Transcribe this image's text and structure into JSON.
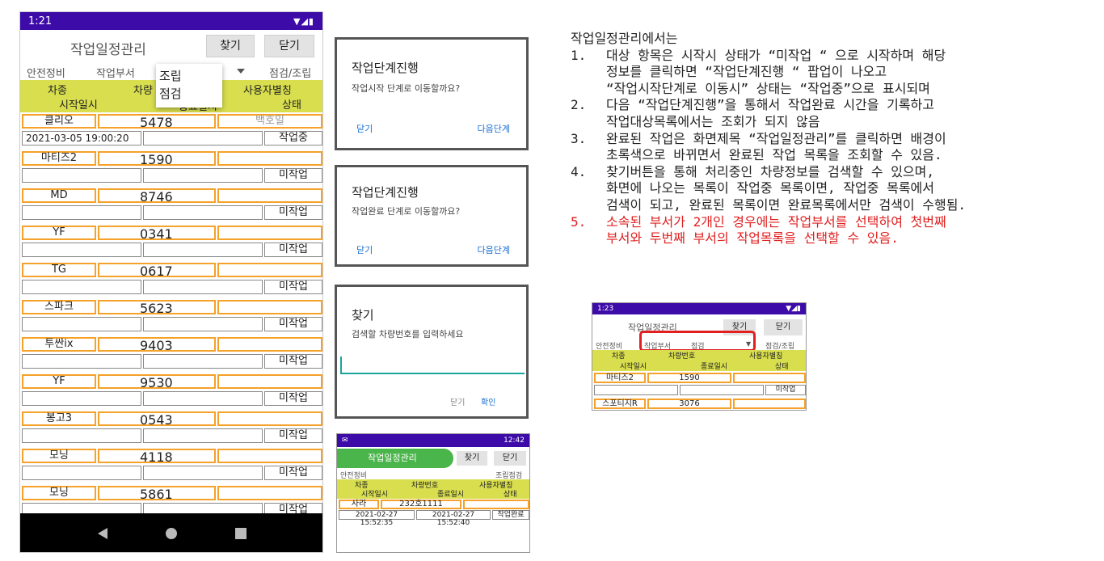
{
  "main_phone": {
    "status_time": "1:21",
    "title": "작업일정관리",
    "find_button": "찾기",
    "close_button": "닫기",
    "filter": {
      "left": "안전정비",
      "dept_label": "작업부서",
      "right": "점검/조립"
    },
    "dropdown_options": [
      "조립",
      "점검"
    ],
    "header": {
      "car_type": "차종",
      "car_no": "차량",
      "user_alias": "사용자별칭",
      "start_time": "시작일시",
      "end_time": "종료일시",
      "status": "상태"
    },
    "rows": [
      {
        "type": "클리오",
        "number": "5478",
        "alias": "백호일",
        "start": "2021-03-05 19:00:20",
        "end": "",
        "status": "작업중"
      },
      {
        "type": "마티즈2",
        "number": "1590",
        "alias": "",
        "start": "",
        "end": "",
        "status": "미작업"
      },
      {
        "type": "MD",
        "number": "8746",
        "alias": "",
        "start": "",
        "end": "",
        "status": "미작업"
      },
      {
        "type": "YF",
        "number": "0341",
        "alias": "",
        "start": "",
        "end": "",
        "status": "미작업"
      },
      {
        "type": "TG",
        "number": "0617",
        "alias": "",
        "start": "",
        "end": "",
        "status": "미작업"
      },
      {
        "type": "스파크",
        "number": "5623",
        "alias": "",
        "start": "",
        "end": "",
        "status": "미작업"
      },
      {
        "type": "투싼ix",
        "number": "9403",
        "alias": "",
        "start": "",
        "end": "",
        "status": "미작업"
      },
      {
        "type": "YF",
        "number": "9530",
        "alias": "",
        "start": "",
        "end": "",
        "status": "미작업"
      },
      {
        "type": "봉고3",
        "number": "0543",
        "alias": "",
        "start": "",
        "end": "",
        "status": "미작업"
      },
      {
        "type": "모닝",
        "number": "4118",
        "alias": "",
        "start": "",
        "end": "",
        "status": "미작업"
      },
      {
        "type": "모닝",
        "number": "5861",
        "alias": "",
        "start": "",
        "end": "",
        "status": "미작업"
      }
    ]
  },
  "dialog1": {
    "title": "작업단계진행",
    "message": "작업시작 단계로 이동할까요?",
    "left": "닫기",
    "right": "다음단계"
  },
  "dialog2": {
    "title": "작업단계진행",
    "message": "작업완료 단계로 이동할까요?",
    "left": "닫기",
    "right": "다음단계"
  },
  "dialog3": {
    "title": "찾기",
    "message": "검색할 차량번호를 입력하세요",
    "cancel": "닫기",
    "ok": "확인"
  },
  "phone2": {
    "status_time": "12:42",
    "title": "작업일정관리",
    "find": "찾기",
    "close": "닫기",
    "filter_left": "안전정비",
    "filter_right": "조립점검",
    "header": {
      "car_type": "차종",
      "car_no": "차량번호",
      "user_alias": "사용자별칭",
      "start": "시작일시",
      "end": "종료일시",
      "status": "상태"
    },
    "row": {
      "type": "사라",
      "number": "232호1111",
      "start": "2021-02-27 15:52:35",
      "end": "2021-02-27 15:52:40",
      "status": "작업완료"
    }
  },
  "description": {
    "heading": "작업일정관리에서는",
    "items": [
      {
        "num": "1.",
        "lines": [
          "대상 항목은 시작시 상태가 “미작업 “ 으로 시작하며 해당",
          "정보를 클릭하면 “작업단계진행 “ 팝업이 나오고",
          "“작업시작단계로 이동시” 상태는 “작업중”으로 표시되며"
        ]
      },
      {
        "num": "2.",
        "lines": [
          "다음 “작업단계진행”을 통해서 작업완료 시간을 기록하고",
          "작업대상목록에서는 조회가 되지 않음"
        ]
      },
      {
        "num": "3.",
        "lines": [
          "완료된 작업은 화면제목 “작업일정관리”를 클릭하면 배경이",
          "초록색으로 바뀌면서 완료된 작업 목록을 조회할 수 있음."
        ]
      },
      {
        "num": "4.",
        "lines": [
          "찾기버튼을 통해 처리중인 차량정보를 검색할 수 있으며,",
          "화면에 나오는 목록이 작업중 목록이면, 작업중 목록에서",
          "검색이 되고, 완료된 목록이면 완료목록에서만 검색이 수행됨."
        ]
      }
    ],
    "red_item": {
      "num": "5.",
      "lines": [
        "소속된 부서가 2개인 경우에는 작업부서를 선택하여 첫번째",
        "부서와 두번째 부서의 작업목록을 선택할 수 있음."
      ]
    }
  },
  "phone3": {
    "status_time": "1:23",
    "title": "작업일정관리",
    "find": "찾기",
    "close": "닫기",
    "filter_left": "안전정비",
    "dept_label": "작업부서",
    "dept_value": "점검",
    "filter_right": "점검/조립",
    "header": {
      "car_type": "차종",
      "car_no": "차량번호",
      "user_alias": "사용자별칭",
      "start": "시작일시",
      "end": "종료일시",
      "status": "상태"
    },
    "rows": [
      {
        "type": "마티즈2",
        "number": "1590",
        "status": "미작업"
      },
      {
        "type": "스포티지R",
        "number": "3076"
      }
    ]
  },
  "colors": {
    "status_bar": "#3d0ba8",
    "header_yellow": "#d8de4e",
    "cell_border_orange": "#f5a12a",
    "green_title": "#4ab54a",
    "red_highlight": "#e02020",
    "link_blue": "#1a6fd1"
  }
}
